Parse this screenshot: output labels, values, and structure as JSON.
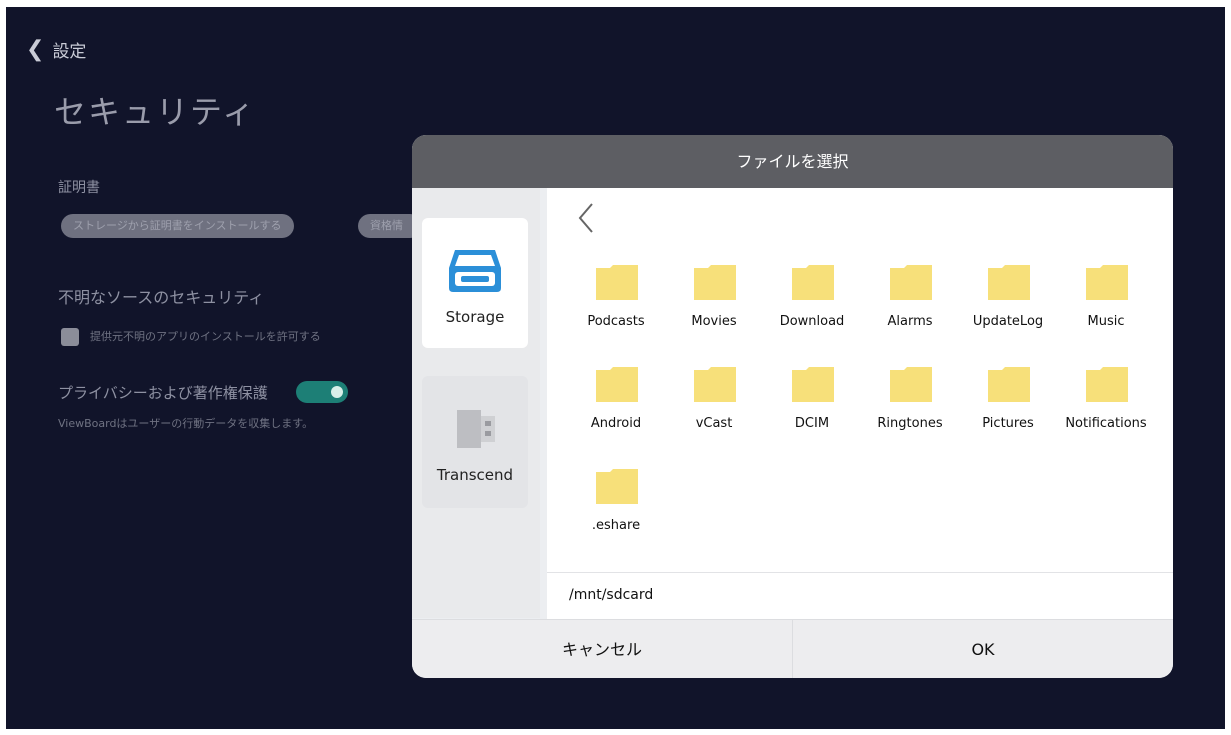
{
  "settings": {
    "back_label": "設定",
    "page_title": "セキュリティ",
    "certificates": {
      "title": "証明書",
      "install_button": "ストレージから証明書をインストールする",
      "second_button": "資格情"
    },
    "unknown_sources": {
      "title": "不明なソースのセキュリティ",
      "checkbox_label": "提供元不明のアプリのインストールを許可する"
    },
    "privacy": {
      "title": "プライバシーおよび著作権保護",
      "description": "ViewBoardはユーザーの行動データを収集します。",
      "toggle_on": true
    }
  },
  "dialog": {
    "title": "ファイルを選択",
    "sources": [
      {
        "label": "Storage",
        "icon": "storage-icon",
        "selected": true
      },
      {
        "label": "Transcend",
        "icon": "usb-drive-icon",
        "selected": false
      }
    ],
    "folders": [
      "Podcasts",
      "Movies",
      "Download",
      "Alarms",
      "UpdateLog",
      "Music",
      "Android",
      "vCast",
      "DCIM",
      "Ringtones",
      "Pictures",
      "Notifications",
      ".eshare"
    ],
    "path": "/mnt/sdcard",
    "cancel_label": "キャンセル",
    "ok_label": "OK"
  },
  "colors": {
    "background": "#11142a",
    "folder": "#f7e07a",
    "storage_accent": "#2b8fd8",
    "toggle_on": "#1d7f76"
  }
}
